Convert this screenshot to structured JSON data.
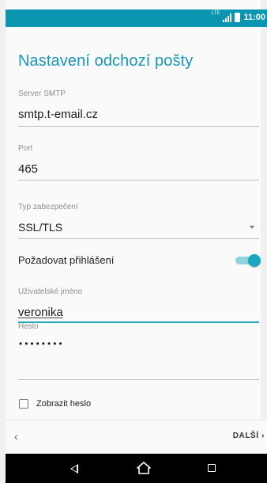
{
  "status_bar": {
    "network": "LTE",
    "time": "11:00"
  },
  "page": {
    "title": "Nastavení odchozí pošty"
  },
  "fields": {
    "server": {
      "label": "Server SMTP",
      "value": "smtp.t-email.cz"
    },
    "port": {
      "label": "Port",
      "value": "465"
    },
    "security": {
      "label": "Typ zabezpečení",
      "value": "SSL/TLS"
    },
    "require_login": {
      "label": "Požadovat přihlášení",
      "enabled": true
    },
    "username": {
      "label": "Uživatelské jméno",
      "value": "veronika"
    },
    "password": {
      "label": "Heslo",
      "value": "••••••••"
    },
    "show_password": {
      "label": "Zobrazit heslo",
      "checked": false
    }
  },
  "bottom": {
    "back_glyph": "‹",
    "next_label": "DALŠÍ ›"
  },
  "colors": {
    "accent": "#1a97b6",
    "statusbar": "#0a95b0",
    "toggle_on": "#17a8c0"
  },
  "icons": {
    "back": "back-triangle-icon",
    "home": "home-icon",
    "recent": "recent-apps-icon"
  }
}
